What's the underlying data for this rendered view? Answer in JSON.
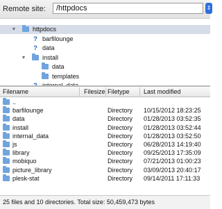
{
  "remote": {
    "label": "Remote site:",
    "path": "/httpdocs",
    "button": "⇕"
  },
  "tree": [
    {
      "name": "httpdocs",
      "type": "folder",
      "expanded": true,
      "selected": true,
      "level": 1
    },
    {
      "name": "barfilounge",
      "type": "unknown",
      "level": 2
    },
    {
      "name": "data",
      "type": "unknown",
      "level": 2
    },
    {
      "name": "install",
      "type": "folder",
      "expanded": true,
      "level": 2
    },
    {
      "name": "data",
      "type": "folder",
      "level": 3
    },
    {
      "name": "templates",
      "type": "folder",
      "level": 3
    },
    {
      "name": "internal_data",
      "type": "unknown",
      "level": 2
    }
  ],
  "columns": {
    "filename": "Filename",
    "filesize": "Filesize",
    "filetype": "Filetype",
    "last_modified": "Last modified"
  },
  "files": [
    {
      "name": "..",
      "type": "",
      "modified": ""
    },
    {
      "name": "barfilounge",
      "type": "Directory",
      "modified": "10/15/2012 18:23:25"
    },
    {
      "name": "data",
      "type": "Directory",
      "modified": "01/28/2013 03:52:35"
    },
    {
      "name": "install",
      "type": "Directory",
      "modified": "01/28/2013 03:52:44"
    },
    {
      "name": "internal_data",
      "type": "Directory",
      "modified": "01/28/2013 03:52:50"
    },
    {
      "name": "js",
      "type": "Directory",
      "modified": "06/28/2013 14:19:40"
    },
    {
      "name": "library",
      "type": "Directory",
      "modified": "09/25/2013 17:35:09"
    },
    {
      "name": "mobiquo",
      "type": "Directory",
      "modified": "07/21/2013 01:00:23"
    },
    {
      "name": "picture_library",
      "type": "Directory",
      "modified": "03/09/2013 20:40:17"
    },
    {
      "name": "plesk-stat",
      "type": "Directory",
      "modified": "09/14/2011 17:11:33"
    }
  ],
  "status": "25 files and 10 directories. Total size: 50,459,473 bytes"
}
